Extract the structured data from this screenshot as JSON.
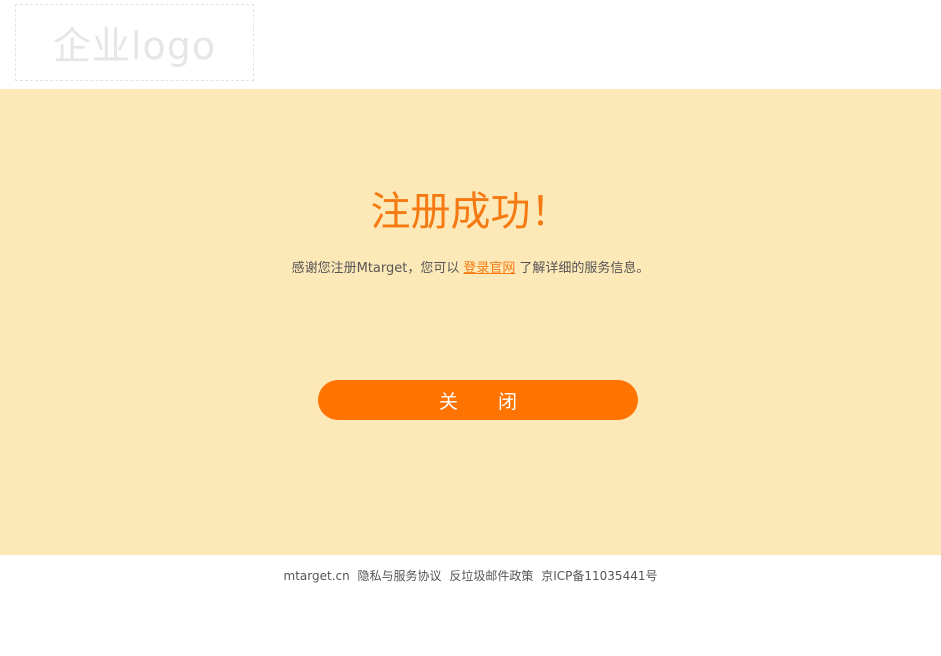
{
  "header": {
    "logo_text": "企业logo"
  },
  "main": {
    "title": "注册成功！",
    "message_before": "感谢您注册Mtarget，您可以",
    "login_link": "登录官网",
    "message_after": "了解详细的服务信息。",
    "close_button": "关闭"
  },
  "footer": {
    "site": "mtarget.cn",
    "privacy": "隐私与服务协议",
    "anti_spam": "反垃圾邮件政策",
    "icp": "京ICP备11035441号"
  },
  "colors": {
    "accent": "#ff7302",
    "title": "#f57a12",
    "band_background": "#fde9b8"
  }
}
